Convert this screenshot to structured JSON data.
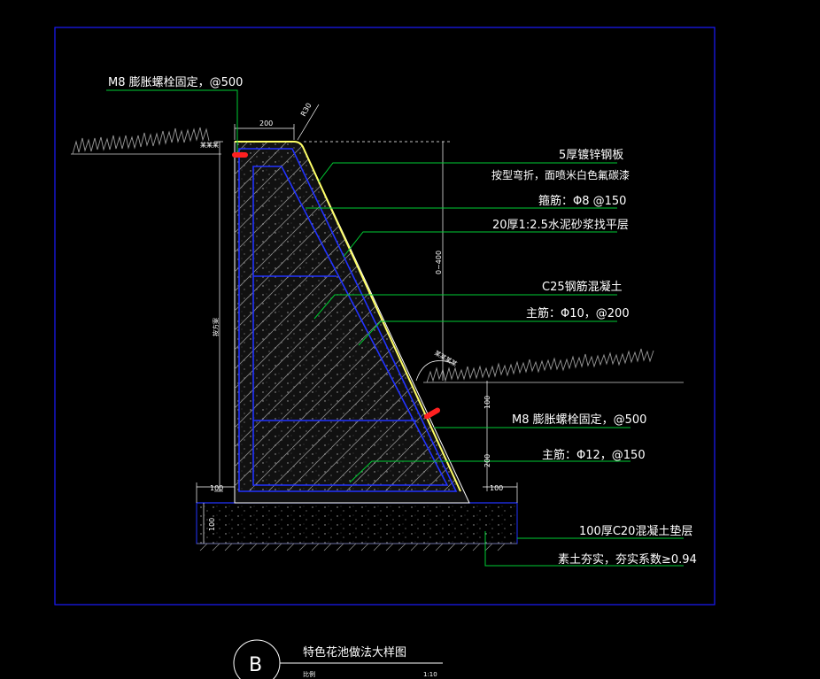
{
  "labels": {
    "top_bolt": "M8 膨胀螺栓固定，@500",
    "steel_plate": "5厚镀锌钢板",
    "steel_plate_note": "按型弯折，面喷米白色氟碳漆",
    "stirrup": "箍筋：Φ8 @150",
    "mortar": "20厚1:2.5水泥砂浆找平层",
    "concrete": "C25钢筋混凝土",
    "main_bar_1": "主筋：Φ10，@200",
    "bottom_bolt": "M8 膨胀螺栓固定，@500",
    "main_bar_2": "主筋：Φ12，@150",
    "cushion": "100厚C20混凝土垫层",
    "soil": "素土夯实，夯实系数≥0.94"
  },
  "dims": {
    "top_width": "200",
    "radius": "R30",
    "height_range": "0~400",
    "wall_height": "按方案",
    "bottom_side_left": "100",
    "bottom_side_right": "100",
    "cushion_thk": "100",
    "ground_100": "100",
    "slope_200": "200",
    "small_tag": "某某某某",
    "tag_left": "某某某"
  },
  "title": {
    "circle_letter": "B",
    "text": "特色花池做法大样图",
    "scale": "1:10",
    "sub": "比例"
  },
  "colors": {
    "frame": "#1a1aff",
    "leader": "#00cc33",
    "text": "#ffffff",
    "rebar": "#2233ff",
    "plate": "#ffff66",
    "bolt": "#ff2020"
  }
}
